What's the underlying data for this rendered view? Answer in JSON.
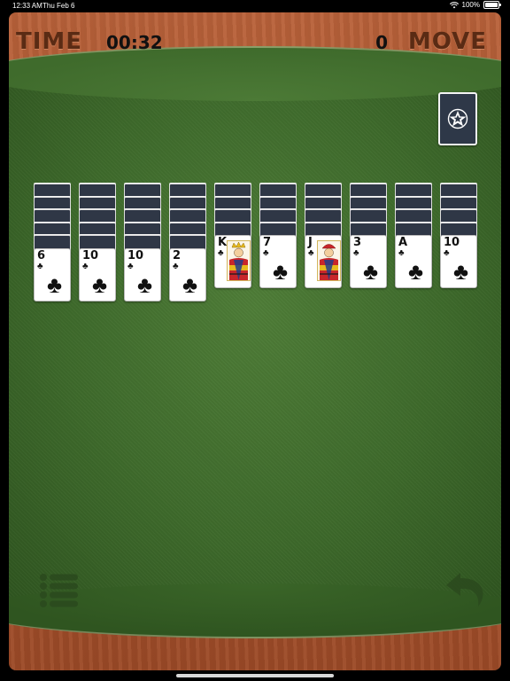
{
  "status_bar": {
    "time": "12:33 AM",
    "date": "Thu Feb 6",
    "battery": "100%"
  },
  "header": {
    "time_label": "TIME",
    "time_value": "00:32",
    "move_value": "0",
    "move_label": "MOVE"
  },
  "colors": {
    "felt": "#3f6b2c",
    "wood": "#a9552e",
    "card_back": "#2f3746",
    "header_text": "#5a2b14"
  },
  "stock": {
    "icon": "star-emblem-icon"
  },
  "tableau": [
    {
      "rank": "6",
      "suit": "♣",
      "face": false,
      "face_down": 5
    },
    {
      "rank": "10",
      "suit": "♣",
      "face": false,
      "face_down": 5
    },
    {
      "rank": "10",
      "suit": "♣",
      "face": false,
      "face_down": 5
    },
    {
      "rank": "2",
      "suit": "♣",
      "face": false,
      "face_down": 5
    },
    {
      "rank": "K",
      "suit": "♣",
      "face": true,
      "face_down": 4
    },
    {
      "rank": "7",
      "suit": "♣",
      "face": false,
      "face_down": 4
    },
    {
      "rank": "J",
      "suit": "♣",
      "face": true,
      "face_down": 4
    },
    {
      "rank": "3",
      "suit": "♣",
      "face": false,
      "face_down": 4
    },
    {
      "rank": "A",
      "suit": "♣",
      "face": false,
      "face_down": 4
    },
    {
      "rank": "10",
      "suit": "♣",
      "face": false,
      "face_down": 4
    }
  ],
  "controls": {
    "menu_icon": "menu-list-icon",
    "undo_icon": "undo-arrow-icon"
  }
}
